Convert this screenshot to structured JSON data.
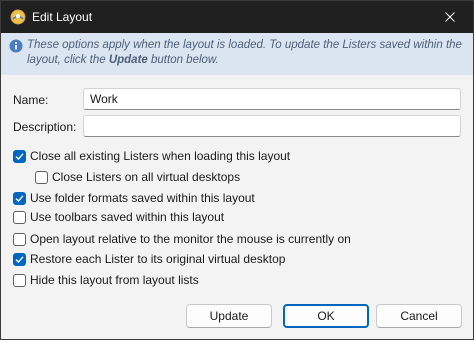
{
  "window": {
    "title": "Edit Layout"
  },
  "info": {
    "text_before": "These options apply when the layout is loaded. To update the Listers saved within the layout, click the ",
    "emphasis": "Update",
    "text_after": " button below."
  },
  "fields": {
    "name_label": "Name:",
    "name_value": "Work",
    "description_label": "Description:",
    "description_value": ""
  },
  "options": [
    {
      "label": "Close all existing Listers when loading this layout",
      "checked": true
    },
    {
      "label": "Close Listers on all virtual desktops",
      "checked": false
    },
    {
      "label": "Use folder formats saved within this layout",
      "checked": true
    },
    {
      "label": "Use toolbars saved within this layout",
      "checked": false
    },
    {
      "label": "Open layout relative to the monitor the mouse is currently on",
      "checked": false
    },
    {
      "label": "Restore each Lister to its original virtual desktop",
      "checked": true
    },
    {
      "label": "Hide this layout from layout lists",
      "checked": false
    }
  ],
  "buttons": {
    "update": "Update",
    "ok": "OK",
    "cancel": "Cancel"
  },
  "colors": {
    "accent": "#0067c0",
    "titlebar": "#202020",
    "info_bar": "#dbe5f1"
  }
}
